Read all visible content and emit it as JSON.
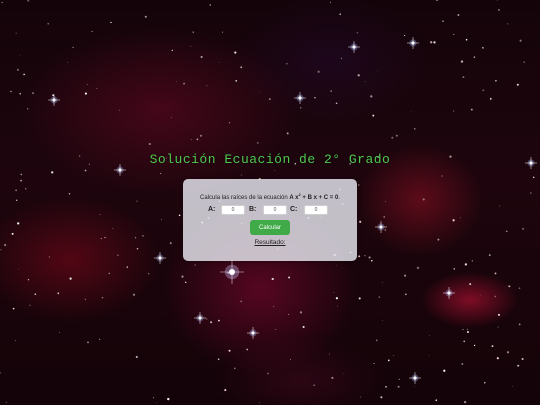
{
  "page": {
    "title": "Solución Ecuación de 2° Grado",
    "background_image": "starfield-nebula"
  },
  "form": {
    "prompt_text": "Calcula las raíces de la ecuación",
    "equation": {
      "a_part": "A x",
      "exponent": "2",
      "rest": " + B x + C = 0",
      "period": "."
    },
    "coefficients": [
      {
        "label": "A:",
        "value": "0"
      },
      {
        "label": "B:",
        "value": "0"
      },
      {
        "label": "C:",
        "value": "0"
      }
    ],
    "calculate_button": "Calcular",
    "result_label": "Resultado:"
  },
  "colors": {
    "title_green": "#4ec94e",
    "button_green": "#3faa47",
    "card_background": "#e4e4ec"
  }
}
